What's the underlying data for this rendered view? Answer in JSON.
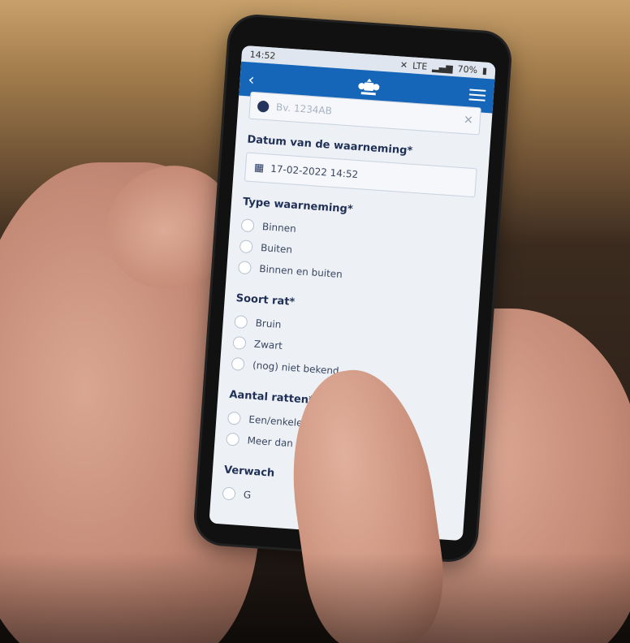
{
  "status": {
    "time": "14:52",
    "battery": "70%",
    "network": "LTE"
  },
  "appbar": {
    "back_icon": "chevron-left-icon",
    "logo_icon": "crest-icon",
    "menu_icon": "hamburger-icon"
  },
  "form": {
    "postcode_placeholder": "Bv. 1234AB",
    "date": {
      "label": "Datum van de waarneming*",
      "value": "17-02-2022 14:52"
    },
    "type": {
      "label": "Type waarneming*",
      "options": [
        "Binnen",
        "Buiten",
        "Binnen en buiten"
      ]
    },
    "soort": {
      "label": "Soort rat*",
      "options": [
        "Bruin",
        "Zwart",
        "(nog) niet bekend"
      ]
    },
    "aantal": {
      "label": "Aantal ratten*",
      "options": [
        "Een/enkele",
        "Meer dan v"
      ]
    },
    "verwacht": {
      "label": "Verwach",
      "option_partial": "G"
    }
  },
  "colors": {
    "appbar": "#1565b8",
    "screen_bg": "#edf1f6",
    "label_text": "#1f2f55"
  }
}
